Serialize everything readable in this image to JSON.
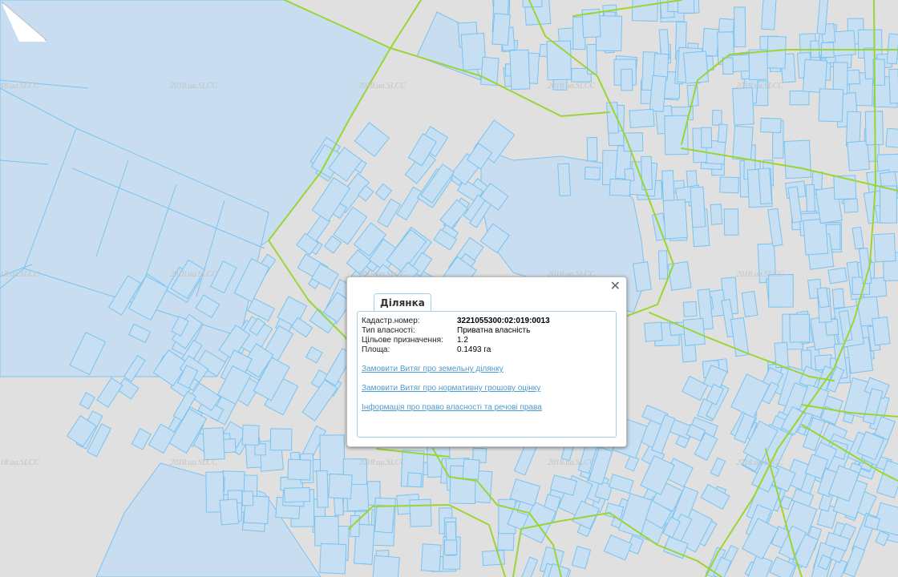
{
  "map": {
    "watermark": "2018.ua.SLCC",
    "colors": {
      "background": "#e0e0e0",
      "parcel_fill": "#c6dff2",
      "parcel_stroke": "#7cc2ee",
      "boundary_stroke": "#9bd435"
    }
  },
  "popup": {
    "tab_label": "Ділянка",
    "close_icon": "close-icon",
    "fields": [
      {
        "label": "Кадастр.номер:",
        "value": "3221055300:02:019:0013"
      },
      {
        "label": "Тип власності:",
        "value": "Приватна власність"
      },
      {
        "label": "Цільове призначення:",
        "value": "1.2"
      },
      {
        "label": "Площа:",
        "value": "0.1493 га"
      }
    ],
    "links": [
      {
        "label": "Замовити Витяг про земельну ділянку"
      },
      {
        "label": "Замовити Витяг про нормативну грошову оцінку"
      },
      {
        "label": "Інформація про право власності та речові права"
      }
    ]
  }
}
